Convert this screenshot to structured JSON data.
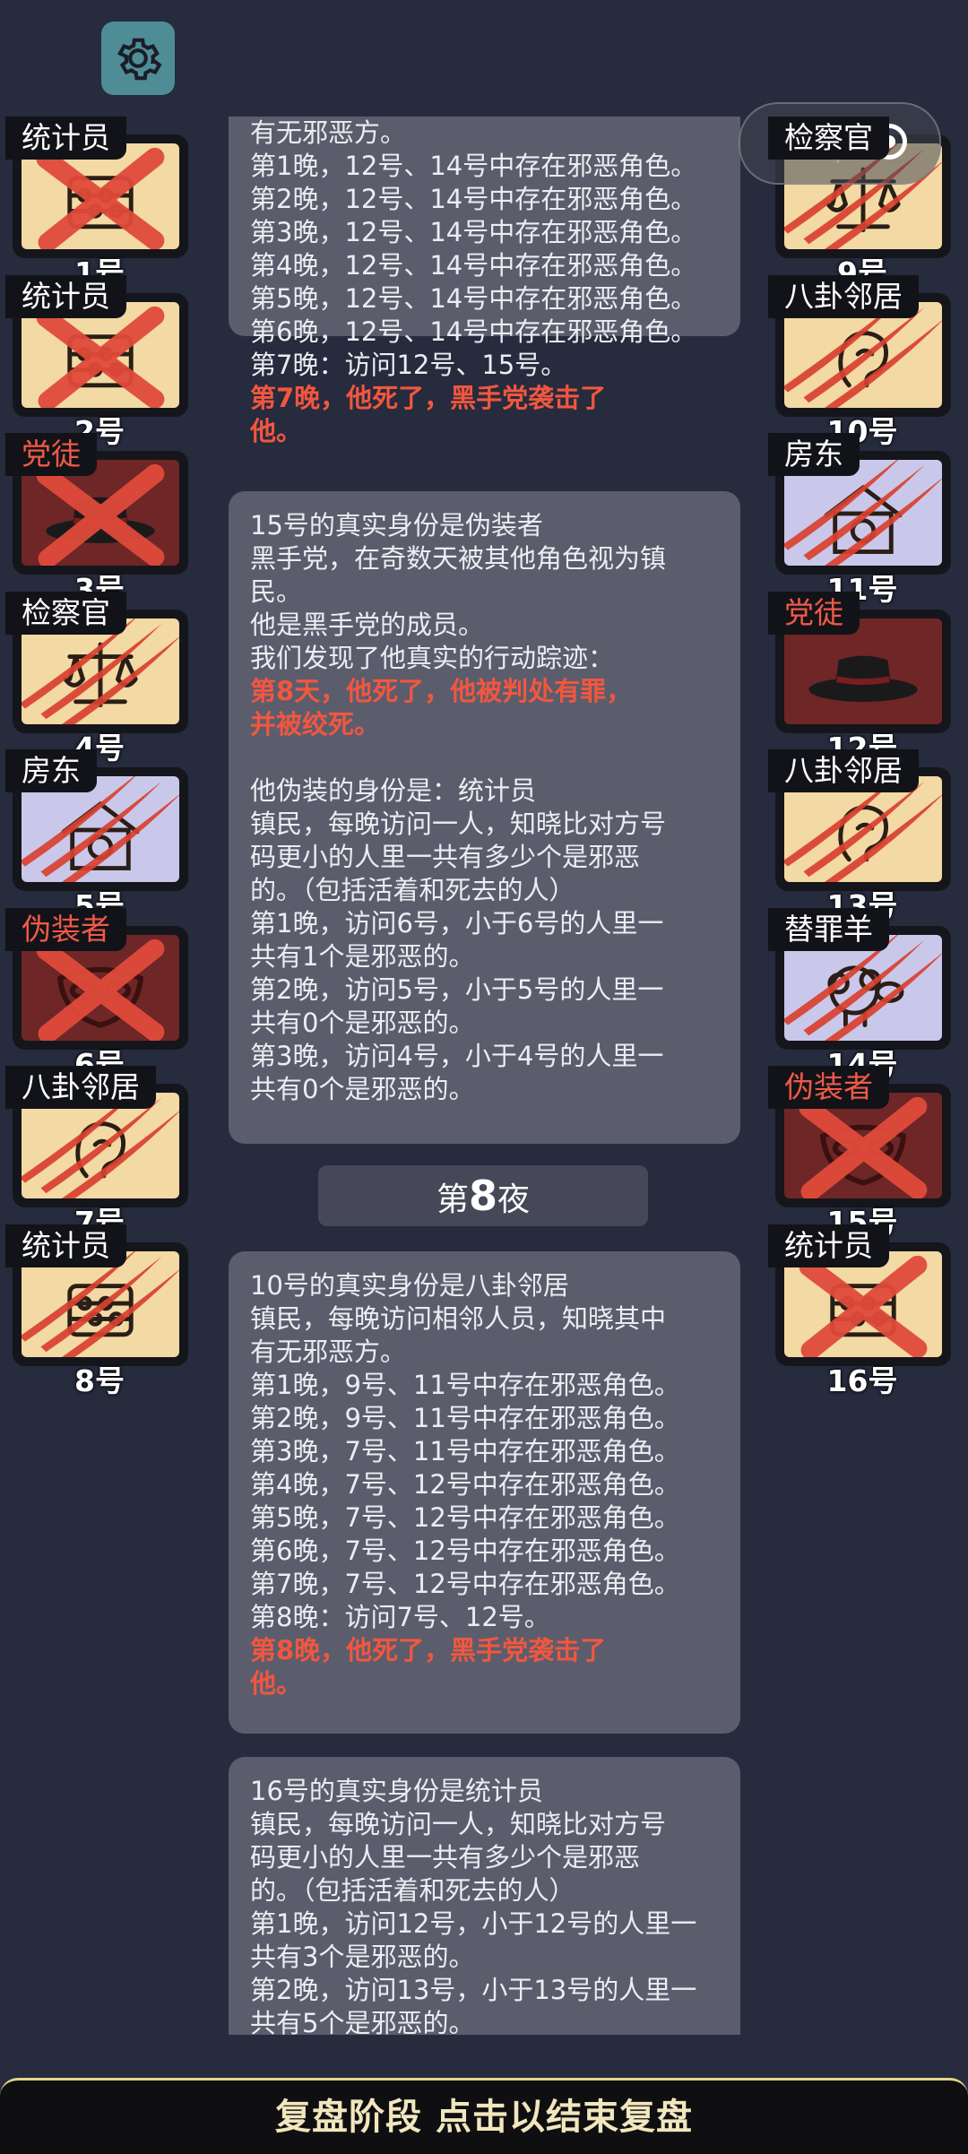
{
  "settings": {
    "icon": "gear-icon"
  },
  "capsule": {
    "menu_icon": "dots-icon",
    "close_icon": "target-icon"
  },
  "players_left": [
    {
      "role": "统计员",
      "number": "1号",
      "role_color": "white",
      "bg": "gold",
      "emblem": "abacus",
      "mark": "x"
    },
    {
      "role": "统计员",
      "number": "2号",
      "role_color": "white",
      "bg": "gold",
      "emblem": "abacus",
      "mark": "x"
    },
    {
      "role": "党徒",
      "number": "3号",
      "role_color": "red",
      "bg": "maroon",
      "emblem": "hat",
      "mark": "x"
    },
    {
      "role": "检察官",
      "number": "4号",
      "role_color": "white",
      "bg": "gold",
      "emblem": "scales",
      "mark": "claw"
    },
    {
      "role": "房东",
      "number": "5号",
      "role_color": "white",
      "bg": "lav",
      "emblem": "house",
      "mark": "claw"
    },
    {
      "role": "伪装者",
      "number": "6号",
      "role_color": "red",
      "bg": "maroon",
      "emblem": "mask",
      "mark": "x"
    },
    {
      "role": "八卦邻居",
      "number": "7号",
      "role_color": "white",
      "bg": "gold",
      "emblem": "ear",
      "mark": "claw"
    },
    {
      "role": "统计员",
      "number": "8号",
      "role_color": "white",
      "bg": "gold",
      "emblem": "abacus",
      "mark": "claw"
    }
  ],
  "players_right": [
    {
      "role": "检察官",
      "number": "9号",
      "role_color": "white",
      "bg": "gold",
      "emblem": "scales",
      "mark": "claw"
    },
    {
      "role": "八卦邻居",
      "number": "10号",
      "role_color": "white",
      "bg": "gold",
      "emblem": "ear",
      "mark": "claw"
    },
    {
      "role": "房东",
      "number": "11号",
      "role_color": "white",
      "bg": "lav",
      "emblem": "house",
      "mark": "claw"
    },
    {
      "role": "党徒",
      "number": "12号",
      "role_color": "red",
      "bg": "maroon",
      "emblem": "hat",
      "mark": "none"
    },
    {
      "role": "八卦邻居",
      "number": "13号",
      "role_color": "white",
      "bg": "gold",
      "emblem": "ear",
      "mark": "claw"
    },
    {
      "role": "替罪羊",
      "number": "14号",
      "role_color": "white",
      "bg": "lav",
      "emblem": "sheep",
      "mark": "claw"
    },
    {
      "role": "伪装者",
      "number": "15号",
      "role_color": "red",
      "bg": "maroon",
      "emblem": "mask",
      "mark": "x"
    },
    {
      "role": "统计员",
      "number": "16号",
      "role_color": "white",
      "bg": "gold",
      "emblem": "abacus",
      "mark": "x"
    }
  ],
  "log": {
    "entry_a": [
      {
        "text": "有无邪恶方。",
        "style": "normal"
      },
      {
        "text": "第1晚，12号、14号中存在邪恶角色。",
        "style": "normal"
      },
      {
        "text": "第2晚，12号、14号中存在邪恶角色。",
        "style": "normal"
      },
      {
        "text": "第3晚，12号、14号中存在邪恶角色。",
        "style": "normal"
      },
      {
        "text": "第4晚，12号、14号中存在邪恶角色。",
        "style": "normal"
      },
      {
        "text": "第5晚，12号、14号中存在邪恶角色。",
        "style": "normal"
      },
      {
        "text": "第6晚，12号、14号中存在邪恶角色。",
        "style": "normal"
      },
      {
        "text": "第7晚：访问12号、15号。",
        "style": "normal"
      },
      {
        "text": "第7晚，他死了，黑手党袭击了",
        "style": "red"
      },
      {
        "text": "他。",
        "style": "red"
      }
    ],
    "entry_b": [
      {
        "text": "15号的真实身份是伪装者",
        "style": "normal"
      },
      {
        "text": "黑手党，在奇数天被其他角色视为镇",
        "style": "normal"
      },
      {
        "text": "民。",
        "style": "normal"
      },
      {
        "text": "他是黑手党的成员。",
        "style": "normal"
      },
      {
        "text": "我们发现了他真实的行动踪迹：",
        "style": "normal"
      },
      {
        "text": "第8天，他死了，他被判处有罪，",
        "style": "red"
      },
      {
        "text": "并被绞死。",
        "style": "red"
      },
      {
        "text": "",
        "style": "gap"
      },
      {
        "text": "他伪装的身份是：统计员",
        "style": "normal"
      },
      {
        "text": "镇民，每晚访问一人，知晓比对方号",
        "style": "normal"
      },
      {
        "text": "码更小的人里一共有多少个是邪恶",
        "style": "normal"
      },
      {
        "text": "的。（包括活着和死去的人）",
        "style": "normal"
      },
      {
        "text": "第1晚，访问6号，小于6号的人里一",
        "style": "normal"
      },
      {
        "text": "共有1个是邪恶的。",
        "style": "normal"
      },
      {
        "text": "第2晚，访问5号，小于5号的人里一",
        "style": "normal"
      },
      {
        "text": "共有0个是邪恶的。",
        "style": "normal"
      },
      {
        "text": "第3晚，访问4号，小于4号的人里一",
        "style": "normal"
      },
      {
        "text": "共有0个是邪恶的。",
        "style": "normal"
      }
    ],
    "night_divider": {
      "prefix": "第",
      "number": "8",
      "suffix": "夜"
    },
    "entry_c": [
      {
        "text": "10号的真实身份是八卦邻居",
        "style": "normal"
      },
      {
        "text": "镇民，每晚访问相邻人员，知晓其中",
        "style": "normal"
      },
      {
        "text": "有无邪恶方。",
        "style": "normal"
      },
      {
        "text": "第1晚，9号、11号中存在邪恶角色。",
        "style": "normal"
      },
      {
        "text": "第2晚，9号、11号中存在邪恶角色。",
        "style": "normal"
      },
      {
        "text": "第3晚，7号、11号中存在邪恶角色。",
        "style": "normal"
      },
      {
        "text": "第4晚，7号、12号中存在邪恶角色。",
        "style": "normal"
      },
      {
        "text": "第5晚，7号、12号中存在邪恶角色。",
        "style": "normal"
      },
      {
        "text": "第6晚，7号、12号中存在邪恶角色。",
        "style": "normal"
      },
      {
        "text": "第7晚，7号、12号中存在邪恶角色。",
        "style": "normal"
      },
      {
        "text": "第8晚：访问7号、12号。",
        "style": "normal"
      },
      {
        "text": "第8晚，他死了，黑手党袭击了",
        "style": "red"
      },
      {
        "text": "他。",
        "style": "red"
      }
    ],
    "entry_d": [
      {
        "text": "16号的真实身份是统计员",
        "style": "normal"
      },
      {
        "text": "镇民，每晚访问一人，知晓比对方号",
        "style": "normal"
      },
      {
        "text": "码更小的人里一共有多少个是邪恶",
        "style": "normal"
      },
      {
        "text": "的。（包括活着和死去的人）",
        "style": "normal"
      },
      {
        "text": "第1晚，访问12号，小于12号的人里一",
        "style": "normal"
      },
      {
        "text": "共有3个是邪恶的。",
        "style": "normal"
      },
      {
        "text": "第2晚，访问13号，小于13号的人里一",
        "style": "normal"
      },
      {
        "text": "共有5个是邪恶的。",
        "style": "normal"
      }
    ]
  },
  "bottom_bar": {
    "label": "复盘阶段 点击以结束复盘"
  },
  "colors": {
    "background": "#262b3d",
    "accent_red": "#f2563f",
    "gold_card": "#f3d9a4",
    "lavender_card": "#c9c8ea",
    "maroon_card": "#6e2626",
    "settings_teal": "#4f8d96"
  }
}
